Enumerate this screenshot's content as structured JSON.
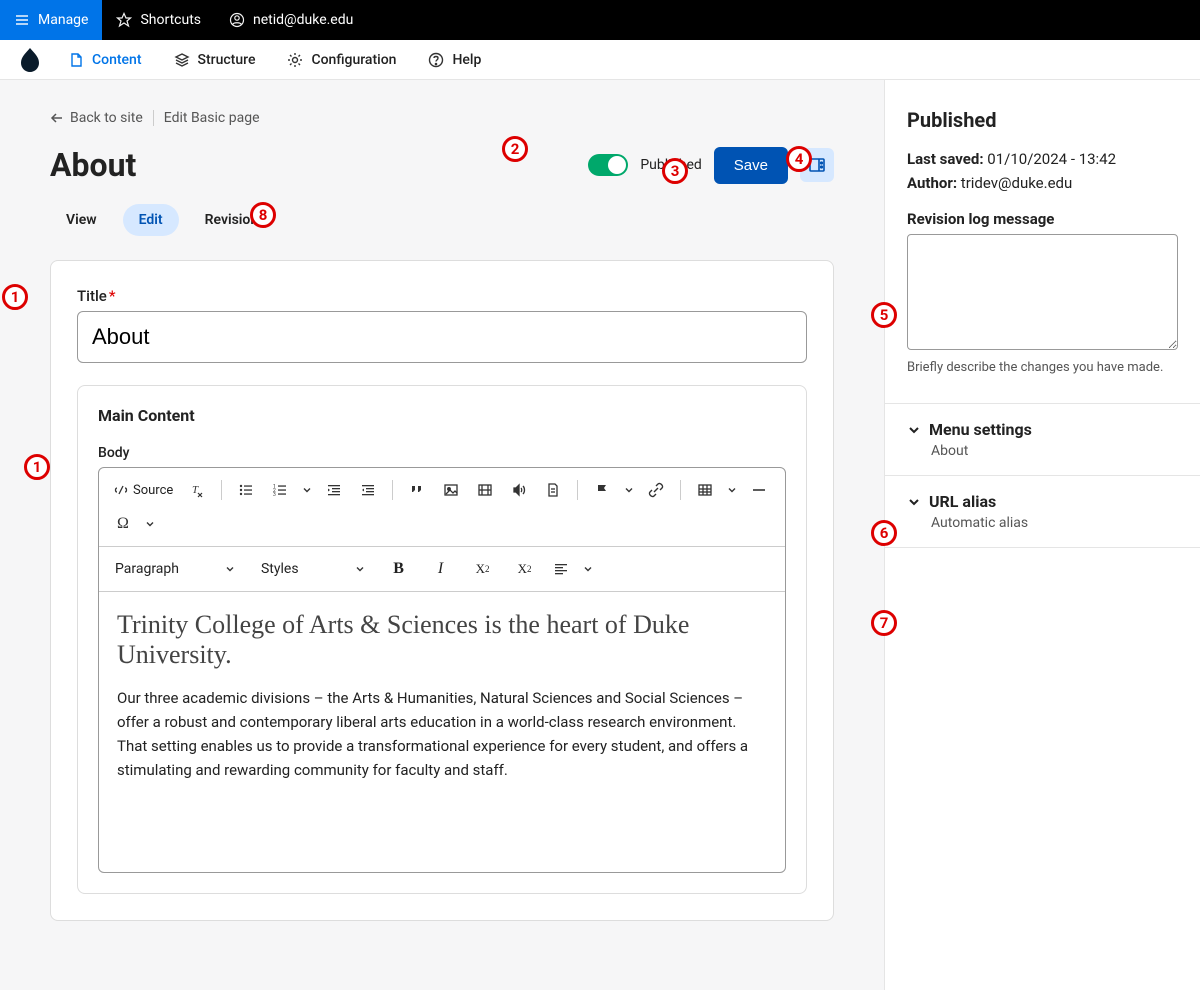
{
  "topbar": {
    "manage": "Manage",
    "shortcuts": "Shortcuts",
    "user": "netid@duke.edu"
  },
  "secondnav": {
    "content": "Content",
    "structure": "Structure",
    "configuration": "Configuration",
    "help": "Help"
  },
  "breadcrumb": {
    "back": "Back to site",
    "current": "Edit Basic page"
  },
  "page_title": "About",
  "header": {
    "published_label": "Published",
    "save": "Save"
  },
  "tabs": {
    "view": "View",
    "edit": "Edit",
    "revisions": "Revisions"
  },
  "form": {
    "title_label": "Title",
    "title_value": "About",
    "main_content": "Main Content",
    "body_label": "Body"
  },
  "editor": {
    "source": "Source",
    "paragraph": "Paragraph",
    "styles": "Styles",
    "heading": "Trinity College of Arts & Sciences is the heart of Duke University.",
    "body_text": "Our three academic divisions – the Arts & Humanities, Natural Sciences and Social Sciences – offer a robust and contemporary liberal arts education in a world-class research environment. That setting enables us to provide a transformational experience for every student, and offers a stimulating and rewarding community for faculty and staff."
  },
  "sidebar": {
    "status": "Published",
    "last_saved_label": "Last saved:",
    "last_saved_value": "01/10/2024 - 13:42",
    "author_label": "Author:",
    "author_value": "tridev@duke.edu",
    "revision_label": "Revision log message",
    "revision_help": "Briefly describe the changes you have made.",
    "menu_settings": "Menu settings",
    "menu_sub": "About",
    "url_alias": "URL alias",
    "url_sub": "Automatic alias"
  },
  "callouts": {
    "c1a": "1",
    "c1b": "1",
    "c2": "2",
    "c3": "3",
    "c4": "4",
    "c5": "5",
    "c6": "6",
    "c7": "7",
    "c8": "8"
  }
}
